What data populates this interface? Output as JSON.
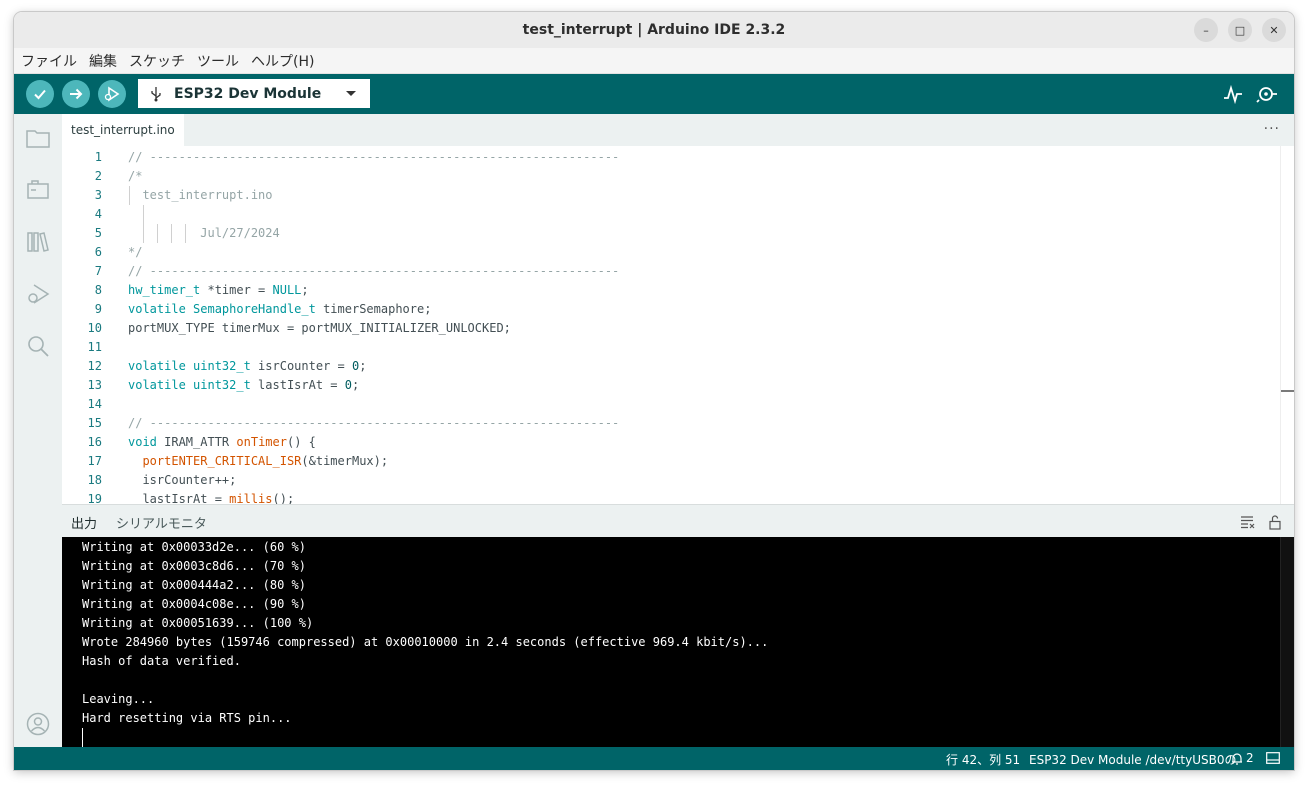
{
  "window": {
    "title": "test_interrupt | Arduino IDE 2.3.2",
    "controls": {
      "minimize": "–",
      "maximize": "□",
      "close": "✕"
    }
  },
  "menu": [
    "ファイル",
    "編集",
    "スケッチ",
    "ツール",
    "ヘルプ(H)"
  ],
  "toolbar": {
    "verify_icon": "check-icon",
    "upload_icon": "arrow-right-icon",
    "debug_icon": "debug-icon",
    "board": "ESP32 Dev Module",
    "serial_plotter_icon": "plotter-icon",
    "serial_monitor_icon": "monitor-icon"
  },
  "sidebar": {
    "icons": [
      "folder-icon",
      "board-manager-icon",
      "library-icon",
      "debug-icon",
      "search-icon",
      "account-icon"
    ]
  },
  "tabs": [
    {
      "label": "test_interrupt.ino"
    }
  ],
  "tab_more": "···",
  "editor": {
    "lines": [
      {
        "n": "1",
        "code": "// -----------------------------------------------------------------"
      },
      {
        "n": "2",
        "code": "/*"
      },
      {
        "n": "3",
        "code": "  test_interrupt.ino"
      },
      {
        "n": "4",
        "code": ""
      },
      {
        "n": "5",
        "code": "          Jul/27/2024"
      },
      {
        "n": "6",
        "code": "*/"
      },
      {
        "n": "7",
        "code": "// -----------------------------------------------------------------"
      },
      {
        "n": "8",
        "code": "hw_timer_t *timer = NULL;"
      },
      {
        "n": "9",
        "code": "volatile SemaphoreHandle_t timerSemaphore;"
      },
      {
        "n": "10",
        "code": "portMUX_TYPE timerMux = portMUX_INITIALIZER_UNLOCKED;"
      },
      {
        "n": "11",
        "code": ""
      },
      {
        "n": "12",
        "code": "volatile uint32_t isrCounter = 0;"
      },
      {
        "n": "13",
        "code": "volatile uint32_t lastIsrAt = 0;"
      },
      {
        "n": "14",
        "code": ""
      },
      {
        "n": "15",
        "code": "// -----------------------------------------------------------------"
      },
      {
        "n": "16",
        "code": "void IRAM_ATTR onTimer() {"
      },
      {
        "n": "17",
        "code": "  portENTER_CRITICAL_ISR(&timerMux);"
      },
      {
        "n": "18",
        "code": "  isrCounter++;"
      },
      {
        "n": "19",
        "code": "  lastIsrAt = millis();"
      }
    ]
  },
  "panel": {
    "tabs": [
      "出力",
      "シリアルモニタ"
    ],
    "clear_icon": "clear-output-icon",
    "lock_icon": "unlock-icon"
  },
  "console": {
    "lines": [
      "Writing at 0x00033d2e... (60 %)",
      "Writing at 0x0003c8d6... (70 %)",
      "Writing at 0x000444a2... (80 %)",
      "Writing at 0x0004c08e... (90 %)",
      "Writing at 0x00051639... (100 %)",
      "Wrote 284960 bytes (159746 compressed) at 0x00010000 in 2.4 seconds (effective 969.4 kbit/s)...",
      "Hash of data verified.",
      "",
      "Leaving...",
      "Hard resetting via RTS pin..."
    ]
  },
  "status": {
    "position": "行 42、列 51",
    "board_port": "ESP32 Dev Module /dev/ttyUSB0の",
    "notifications": "2",
    "notification_icon": "bell-icon",
    "panel_toggle_icon": "panel-icon"
  },
  "colors": {
    "teal": "#006468",
    "teal_light": "#4db7bb",
    "keyword": "#00979c",
    "function": "#d35400",
    "comment": "#95a5a6"
  }
}
